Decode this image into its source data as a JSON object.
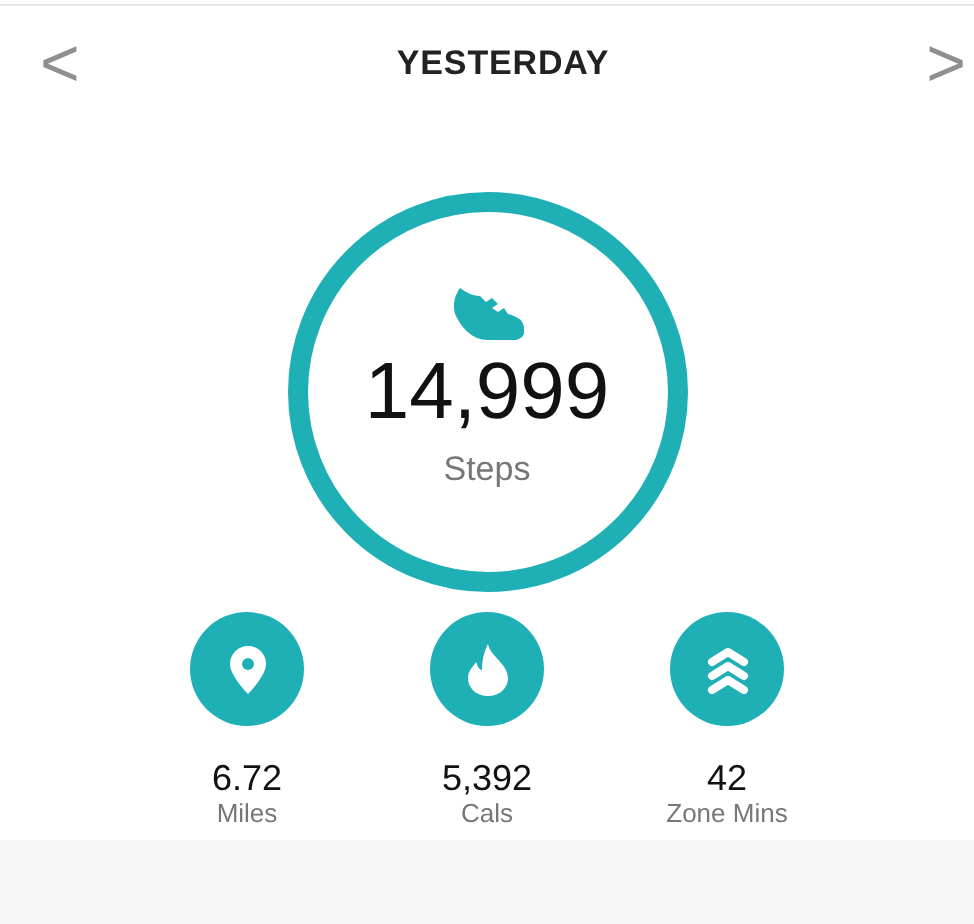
{
  "header": {
    "prev": "<",
    "title": "YESTERDAY",
    "next": ">"
  },
  "main_stat": {
    "value": "14,999",
    "label": "Steps"
  },
  "stats": [
    {
      "kind": "pin",
      "value": "6.72",
      "label": "Miles"
    },
    {
      "kind": "flame",
      "value": "5,392",
      "label": "Cals"
    },
    {
      "kind": "zone",
      "value": "42",
      "label": "Zone Mins"
    }
  ]
}
